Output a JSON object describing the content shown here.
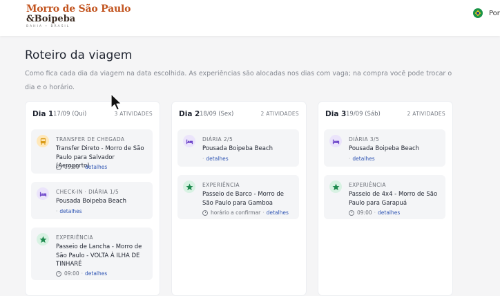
{
  "header": {
    "logo_line1": "Morro de São Paulo",
    "logo_line2": "&Boipeba",
    "logo_sub": "BAHIA • BRASIL",
    "lang_label": "Port"
  },
  "page": {
    "title": "Roteiro da viagem",
    "description": "Como fica cada dia da viagem na data escolhida. As experiências são alocadas nos dias com vaga; na compra você pode trocar o dia e o horário."
  },
  "days": [
    {
      "label": "Dia 1",
      "date": "17/09 (Qui)",
      "count": "3 ATIVIDADES",
      "activities": [
        {
          "icon": "bus-icon",
          "color": "orange",
          "type": "TRANSFER DE CHEGADA",
          "title": "Transfer Direto - Morro de São Paulo para Salvador (Aeroporto)",
          "time": "09:00",
          "link": "detalhes"
        },
        {
          "icon": "bed-icon",
          "color": "purple",
          "type": "CHECK-IN · DIÁRIA 1/5",
          "title": "Pousada Boipeba Beach",
          "time": "",
          "link": "detalhes"
        },
        {
          "icon": "star-icon",
          "color": "green",
          "type": "EXPERIÊNCIA",
          "title": "Passeio de Lancha - Morro de São Paulo - VOLTA À ILHA DE TINHARÉ",
          "time": "09:00",
          "link": "detalhes"
        }
      ]
    },
    {
      "label": "Dia 2",
      "date": "18/09 (Sex)",
      "count": "2 ATIVIDADES",
      "activities": [
        {
          "icon": "bed-icon",
          "color": "purple",
          "type": "DIÁRIA 2/5",
          "title": "Pousada Boipeba Beach",
          "time": "",
          "link": "detalhes"
        },
        {
          "icon": "star-icon",
          "color": "green",
          "type": "EXPERIÊNCIA",
          "title": "Passeio de Barco - Morro de São Paulo para Gamboa",
          "time": "horário a confirmar",
          "link": "detalhes"
        }
      ]
    },
    {
      "label": "Dia 3",
      "date": "19/09 (Sáb)",
      "count": "2 ATIVIDADES",
      "activities": [
        {
          "icon": "bed-icon",
          "color": "purple",
          "type": "DIÁRIA 3/5",
          "title": "Pousada Boipeba Beach",
          "time": "",
          "link": "detalhes"
        },
        {
          "icon": "star-icon",
          "color": "green",
          "type": "EXPERIÊNCIA",
          "title": "Passeio de 4x4 - Morro de São Paulo para Garapuá",
          "time": "09:00",
          "link": "detalhes"
        }
      ]
    }
  ],
  "colors": {
    "brand": "#c2541f",
    "link": "#2f55b3",
    "bus_icon": "#d99a16",
    "bed_icon": "#6c44c9",
    "star_icon": "#1e8a4e"
  }
}
